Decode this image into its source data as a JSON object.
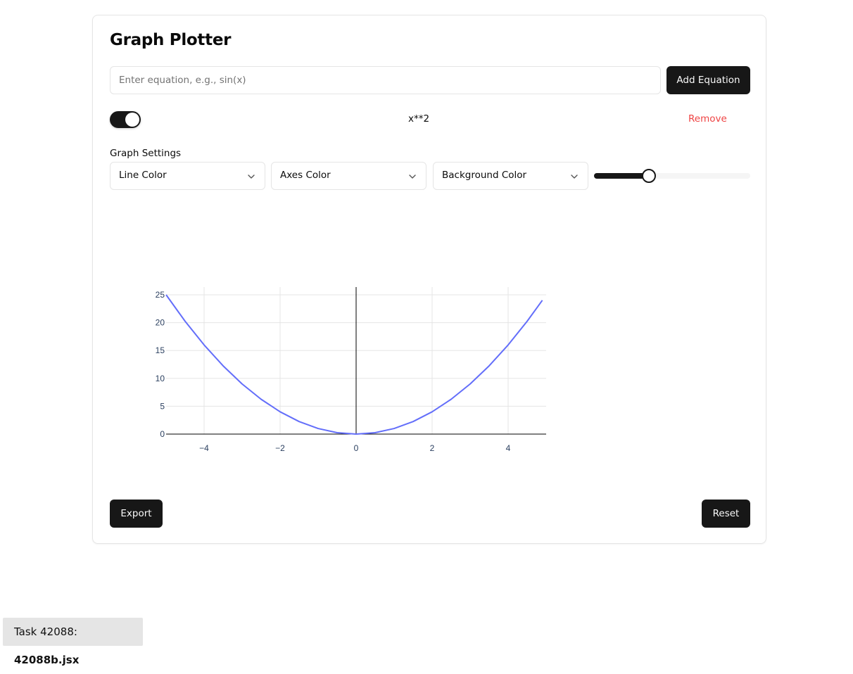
{
  "app": {
    "title": "Graph Plotter"
  },
  "equation_input": {
    "value": "",
    "placeholder": "Enter equation, e.g., sin(x)"
  },
  "buttons": {
    "add_equation": "Add Equation",
    "export": "Export",
    "reset": "Reset"
  },
  "equations": [
    {
      "expression": "x**2",
      "enabled": true,
      "remove_label": "Remove"
    }
  ],
  "settings": {
    "label": "Graph Settings",
    "line_color_placeholder": "Line Color",
    "axes_color_placeholder": "Axes Color",
    "background_color_placeholder": "Background Color",
    "slider_value_fraction": 0.35
  },
  "colors": {
    "primary": "#171717",
    "remove": "#ef4444",
    "plot_line": "#636efa",
    "grid": "#e5e5e5"
  },
  "chart_data": {
    "type": "line",
    "title": "",
    "xlabel": "",
    "ylabel": "",
    "xlim": [
      -5,
      5
    ],
    "ylim": [
      0,
      25
    ],
    "x_ticks": [
      "−4",
      "−2",
      "0",
      "2",
      "4"
    ],
    "x_tick_values": [
      -4,
      -2,
      0,
      2,
      4
    ],
    "y_ticks": [
      "0",
      "5",
      "10",
      "15",
      "20",
      "25"
    ],
    "y_tick_values": [
      0,
      5,
      10,
      15,
      20,
      25
    ],
    "grid": true,
    "series": [
      {
        "x": [
          -5,
          -4.5,
          -4,
          -3.5,
          -3,
          -2.5,
          -2,
          -1.5,
          -1,
          -0.5,
          0,
          0.5,
          1,
          1.5,
          2,
          2.5,
          3,
          3.5,
          4,
          4.5,
          4.9
        ],
        "y": [
          25,
          20.25,
          16,
          12.25,
          9,
          6.25,
          4,
          2.25,
          1,
          0.25,
          0,
          0.25,
          1,
          2.25,
          4,
          6.25,
          9,
          12.25,
          16,
          20.25,
          24.01
        ]
      }
    ]
  },
  "footer": {
    "task_prefix": "Task 42088: ",
    "file_name": "42088b.jsx"
  }
}
